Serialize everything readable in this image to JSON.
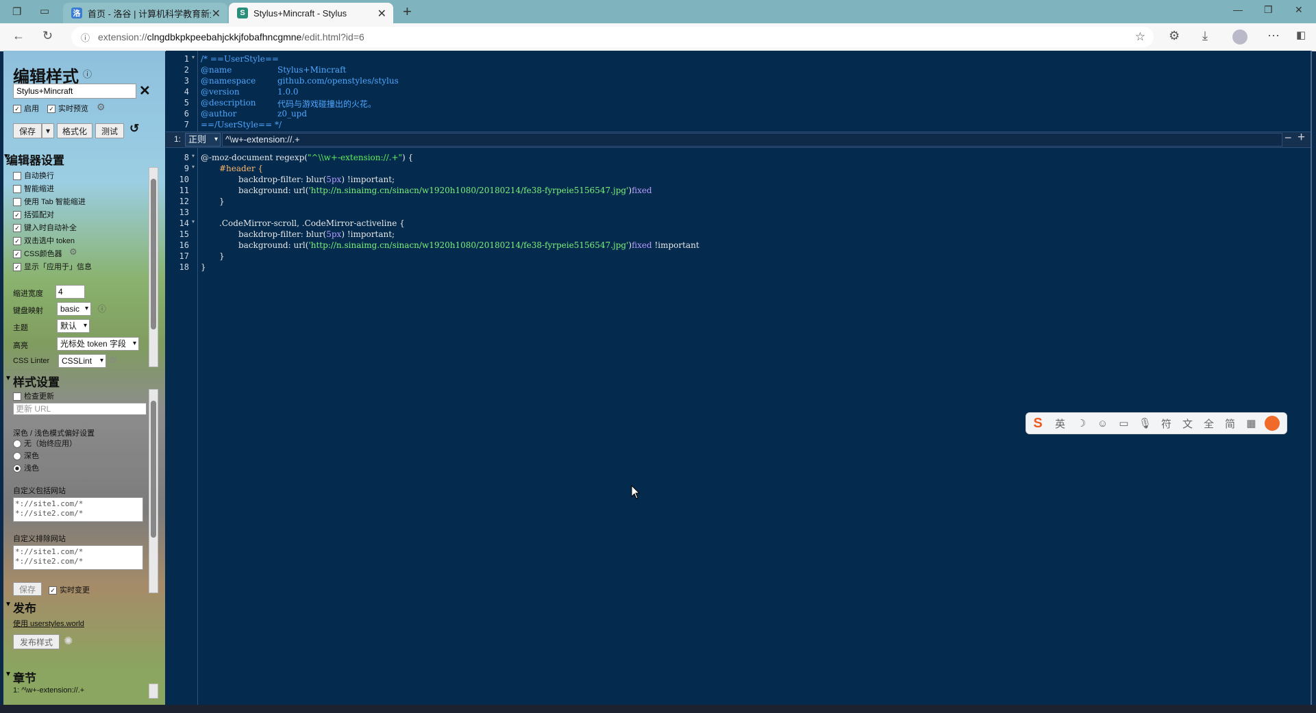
{
  "browser": {
    "tabs": [
      {
        "title": "首页 - 洛谷 | 计算机科学教育新生",
        "active": false,
        "favicon": "luogu-icon"
      },
      {
        "title": "Stylus+Mincraft - Stylus",
        "active": true,
        "favicon": "stylus-icon"
      }
    ],
    "url_prefix": "extension://",
    "url_host": "clngdbkpkpeebahjckkjfobafhncgmne",
    "url_path": "/edit.html?id=6"
  },
  "sidebar": {
    "title": "编辑样式",
    "style_name": "Stylus+Mincraft",
    "enable_label": "启用",
    "live_preview_label": "实时预览",
    "save_label": "保存",
    "format_label": "格式化",
    "test_label": "测试",
    "editor_settings": {
      "heading": "编辑器设置",
      "options": [
        {
          "label": "自动换行",
          "checked": false
        },
        {
          "label": "智能缩进",
          "checked": false
        },
        {
          "label": "使用 Tab 智能缩进",
          "checked": false
        },
        {
          "label": "括弧配对",
          "checked": true
        },
        {
          "label": "键入时自动补全",
          "checked": true
        },
        {
          "label": "双击选中 token",
          "checked": true
        },
        {
          "label": "CSS颜色器",
          "checked": true
        },
        {
          "label": "显示「应用于」信息",
          "checked": true
        }
      ],
      "indent_label": "缩进宽度",
      "indent_value": "4",
      "keymap_label": "键盘映射",
      "keymap_value": "basic",
      "theme_label": "主题",
      "theme_value": "默认",
      "highlight_label": "高亮",
      "highlight_value": "光标处 token 字段",
      "linter_label": "CSS Linter",
      "linter_value": "CSSLint"
    },
    "style_settings": {
      "heading": "样式设置",
      "check_updates_label": "检查更新",
      "update_url_placeholder": "更新 URL",
      "scheme_label": "深色 / 浅色模式偏好设置",
      "scheme_options": [
        {
          "label": "无（始终应用）",
          "selected": false
        },
        {
          "label": "深色",
          "selected": false
        },
        {
          "label": "浅色",
          "selected": true
        }
      ],
      "include_label": "自定义包括网站",
      "include_placeholder": "*://site1.com/*\n*://site2.com/*",
      "exclude_label": "自定义排除网站",
      "exclude_placeholder": "*://site1.com/*\n*://site2.com/*",
      "save_label": "保存",
      "live_change_label": "实时变更"
    },
    "publish": {
      "heading": "发布",
      "link_label": "使用 userstyles.world",
      "button_label": "发布样式"
    },
    "sections": {
      "heading": "章节",
      "item": "1: ^\\w+-extension://.+"
    }
  },
  "editor": {
    "section_index": "1:",
    "section_type": "正则",
    "section_value": "^\\w+-extension://.+",
    "header_lines": [
      {
        "n": "1",
        "text": "/* ==UserStyle=="
      },
      {
        "n": "2",
        "key": "@name",
        "val": "Stylus+Mincraft"
      },
      {
        "n": "3",
        "key": "@namespace",
        "val": "github.com/openstyles/stylus"
      },
      {
        "n": "4",
        "key": "@version",
        "val": "1.0.0"
      },
      {
        "n": "5",
        "key": "@description",
        "val": "代码与游戏碰撞出的火花。"
      },
      {
        "n": "6",
        "key": "@author",
        "val": "z0_upd"
      },
      {
        "n": "7",
        "text": "==/UserStyle== */"
      }
    ],
    "body_line_numbers": [
      "8",
      "9",
      "10",
      "11",
      "12",
      "13",
      "14",
      "15",
      "16",
      "17",
      "18"
    ],
    "code": {
      "l8_a": "@-moz-document regexp(",
      "l8_b": "\"^\\\\w+-extension://.+\"",
      "l8_c": ") {",
      "l9": "#header {",
      "l10_a": "backdrop-filter: blur(",
      "l10_b": "5px",
      "l10_c": ") !important;",
      "l11_a": "background: url(",
      "l11_b": "'http://n.sinaimg.cn/sinacn/w1920h1080/20180214/fe38-fyrpeie5156547.jpg'",
      "l11_c": ")",
      "l11_d": "fixed",
      "l12": "}",
      "l14": ".CodeMirror-scroll, .CodeMirror-activeline {",
      "l15_a": "backdrop-filter: blur(",
      "l15_b": "5px",
      "l15_c": ") !important;",
      "l16_a": "background: url(",
      "l16_b": "'http://n.sinaimg.cn/sinacn/w1920h1080/20180214/fe38-fyrpeie5156547.jpg'",
      "l16_c": ")",
      "l16_d": "fixed",
      "l16_e": " !important",
      "l17": "}",
      "l18": "}"
    }
  },
  "ime_toolbar": {
    "items": [
      "英",
      "☽",
      "☺",
      "▭",
      "🎙",
      "符",
      "⽂",
      "全",
      "简",
      "▦"
    ]
  },
  "colors": {
    "editor_bg": "#042a4d",
    "tab_strip": "#7fb3bd"
  }
}
